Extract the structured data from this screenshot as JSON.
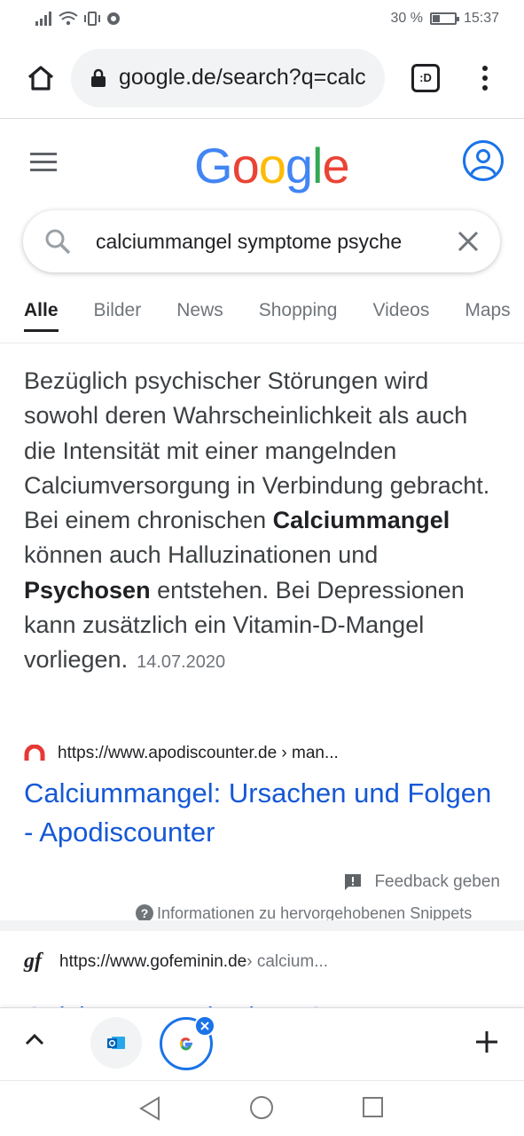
{
  "status": {
    "battery_percent": "30 %",
    "battery_level": 0.3,
    "time": "15:37"
  },
  "browser": {
    "url": "google.de/search?q=calciummangel+symptome+psyche",
    "tab_switcher_label": ":D"
  },
  "search": {
    "query": "calciummangel symptome psyche"
  },
  "tabs": [
    {
      "label": "Alle",
      "active": true
    },
    {
      "label": "Bilder"
    },
    {
      "label": "News"
    },
    {
      "label": "Shopping"
    },
    {
      "label": "Videos"
    },
    {
      "label": "Maps"
    }
  ],
  "snippet": {
    "part1": "Bezüglich psychischer Störungen wird sowohl deren Wahrscheinlichkeit als auch die Intensität mit einer mangelnden Calciumversorgung in Verbindung gebracht. Bei einem chronischen ",
    "bold1": "Calciummangel",
    "part2": " können auch Halluzinationen und ",
    "bold2": "Psychosen",
    "part3": " entstehen. Bei Depressionen kann zusätzlich ein Vitamin-D-Mangel vorliegen.",
    "date": "14.07.2020"
  },
  "result1": {
    "url": "https://www.apodiscounter.de › man...",
    "title": "Calciummangel: Ursachen und Folgen - Apodiscounter"
  },
  "feedback": {
    "label": "Feedback geben",
    "info": "Informationen zu hervorgehobenen Snippets"
  },
  "result2": {
    "favicon_text": "gf",
    "url": "https://www.gofeminin.de",
    "crumb": " › calcium...",
    "title_peek": "Calciummangel: Diese Symptome"
  },
  "colors": {
    "link": "#1558d6",
    "accent": "#1a73e8",
    "apodiscounter_red": "#e53935"
  }
}
